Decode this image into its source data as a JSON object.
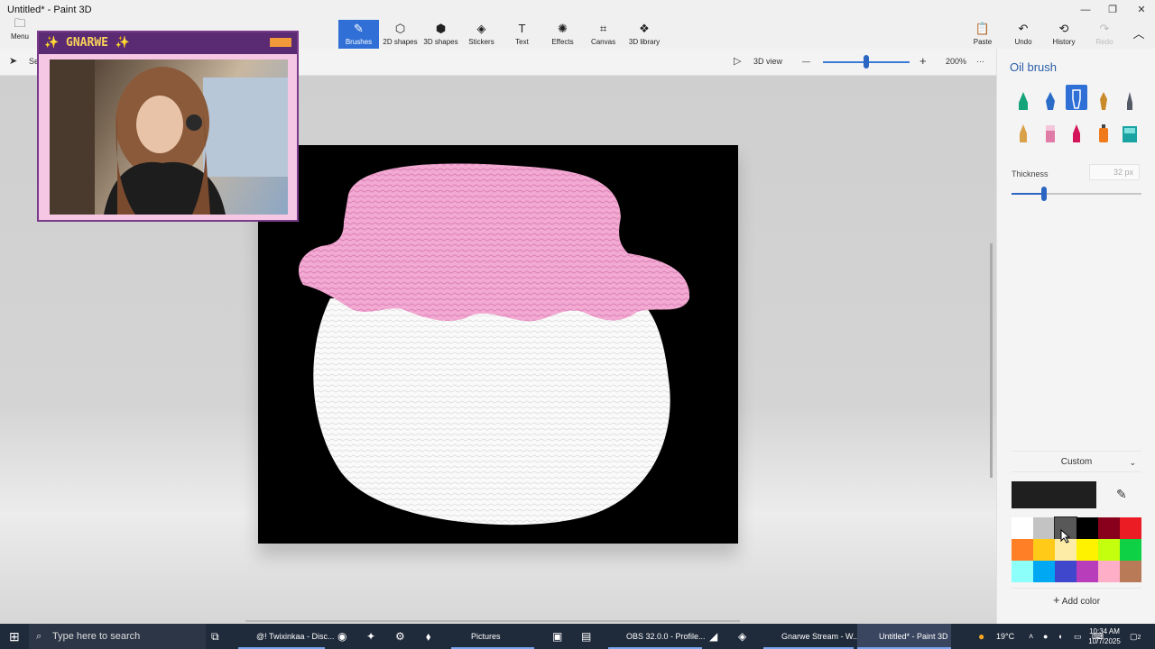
{
  "window": {
    "title": "Untitled* - Paint 3D",
    "minimize": "—",
    "maximize": "❐",
    "close": "✕"
  },
  "ribbon": {
    "menu": "Menu",
    "tools": [
      {
        "label": "Brushes",
        "icon": "✎"
      },
      {
        "label": "2D shapes",
        "icon": "⬡"
      },
      {
        "label": "3D shapes",
        "icon": "⬢"
      },
      {
        "label": "Stickers",
        "icon": "◈"
      },
      {
        "label": "Text",
        "icon": "T"
      },
      {
        "label": "Effects",
        "icon": "✺"
      },
      {
        "label": "Canvas",
        "icon": "⌗"
      },
      {
        "label": "3D library",
        "icon": "❖"
      }
    ],
    "right": [
      {
        "label": "Paste",
        "icon": "📋"
      },
      {
        "label": "Undo",
        "icon": "↶"
      },
      {
        "label": "History",
        "icon": "⟲"
      },
      {
        "label": "Redo",
        "icon": "↷"
      }
    ],
    "collapse": "︿"
  },
  "subbar": {
    "select": "Se",
    "view3d": "3D view",
    "zoom_out": "—",
    "zoom_in": "+",
    "zoom": "200%",
    "zoom_level": 0.5,
    "more": "···"
  },
  "overlay": {
    "title": "✨ GNARWE ✨"
  },
  "panel": {
    "title": "Oil brush",
    "brushes": [
      {
        "name": "marker-brush-icon",
        "color": "#17a37a"
      },
      {
        "name": "calligraphy-pen-icon",
        "color": "#2b6cc9"
      },
      {
        "name": "oil-brush-icon",
        "color": "#ffffff"
      },
      {
        "name": "watercolor-brush-icon",
        "color": "#c98a2b"
      },
      {
        "name": "pixel-pen-icon",
        "color": "#555b66"
      },
      {
        "name": "pencil-icon",
        "color": "#d9a24a"
      },
      {
        "name": "eraser-icon",
        "color": "#e07aa6"
      },
      {
        "name": "crayon-icon",
        "color": "#d4145a"
      },
      {
        "name": "spray-can-icon",
        "color": "#f07a1a"
      },
      {
        "name": "fill-bucket-icon",
        "color": "#1aa3a3"
      }
    ],
    "thickness_label": "Thickness",
    "thickness_value": "32 px",
    "thickness_level": 0.25,
    "color_mode": "Custom",
    "current_color": "#1f1f1f",
    "swatches": [
      "#ffffff",
      "#c3c3c3",
      "#585858",
      "#000000",
      "#88001b",
      "#ec1c24",
      "#ff7f27",
      "#ffca18",
      "#fdeca6",
      "#fff200",
      "#c4ff0e",
      "#0ed145",
      "#8cfffb",
      "#00a8f3",
      "#3f48cc",
      "#b83dba",
      "#ffaec8",
      "#b97a57"
    ],
    "add_color": "Add color"
  },
  "taskbar": {
    "search_placeholder": "Type here to search",
    "items": [
      {
        "label": "@! Twixinkaa - Disc..."
      },
      {
        "label": "Pictures"
      },
      {
        "label": "OBS 32.0.0 - Profile..."
      },
      {
        "label": "Gnarwe Stream - W..."
      },
      {
        "label": "Untitled* - Paint 3D"
      }
    ],
    "weather": "19°C",
    "time": "10:34 AM",
    "date": "10/7/2025",
    "notifications": "2"
  }
}
